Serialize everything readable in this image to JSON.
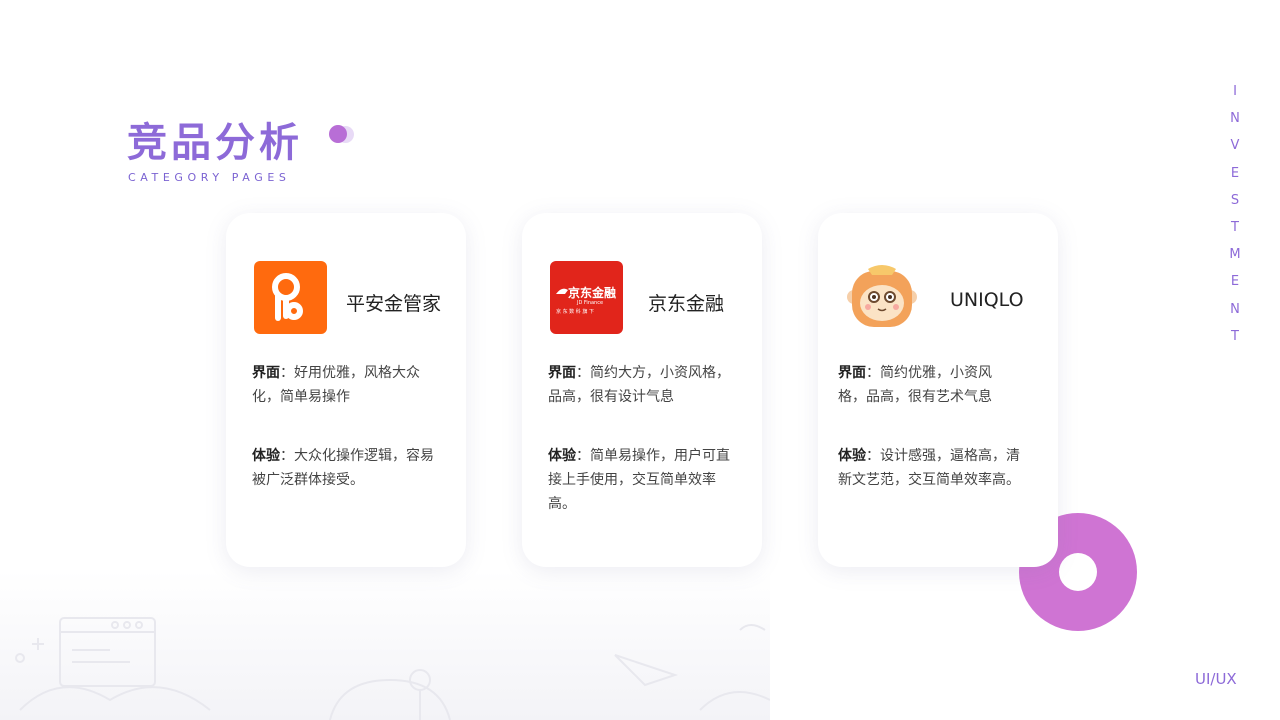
{
  "header": {
    "title": "竞品分析",
    "subtitle": "CATEGORY PAGES"
  },
  "side_label": [
    "I",
    "N",
    "V",
    "E",
    "S",
    "T",
    "M",
    "E",
    "N",
    "T"
  ],
  "footer_label": "UI/UX",
  "colors": {
    "accent": "#8d6ad8",
    "donut": "#cf74d3",
    "pingan_orange": "#ff6a0e",
    "jd_red": "#e1251b"
  },
  "cards": [
    {
      "brand": "平安金管家",
      "logo_icon": "pingan-key-icon",
      "ui_label": "界面",
      "ui_text": "：好用优雅，风格大众化，简单易操作",
      "ux_label": "体验",
      "ux_text": "：大众化操作逻辑，容易被广泛群体接受。"
    },
    {
      "brand": "京东金融",
      "logo_icon": "jd-finance-logo-icon",
      "logo_title": "京东金融",
      "logo_sub": "JD Finance",
      "logo_tag": "京 东 数 科 旗 下",
      "ui_label": "界面",
      "ui_text": "：简约大方，小资风格，品高，很有设计气息",
      "ux_label": "体验",
      "ux_text": "：简单易操作，用户可直接上手使用，交互简单效率高。"
    },
    {
      "brand": "UNIQLO",
      "logo_icon": "monkey-mascot-icon",
      "ui_label": "界面",
      "ui_text": "：简约优雅，小资风格，品高，很有艺术气息",
      "ux_label": "体验",
      "ux_text": "：设计感强，逼格高，清新文艺范，交互简单效率高。"
    }
  ]
}
